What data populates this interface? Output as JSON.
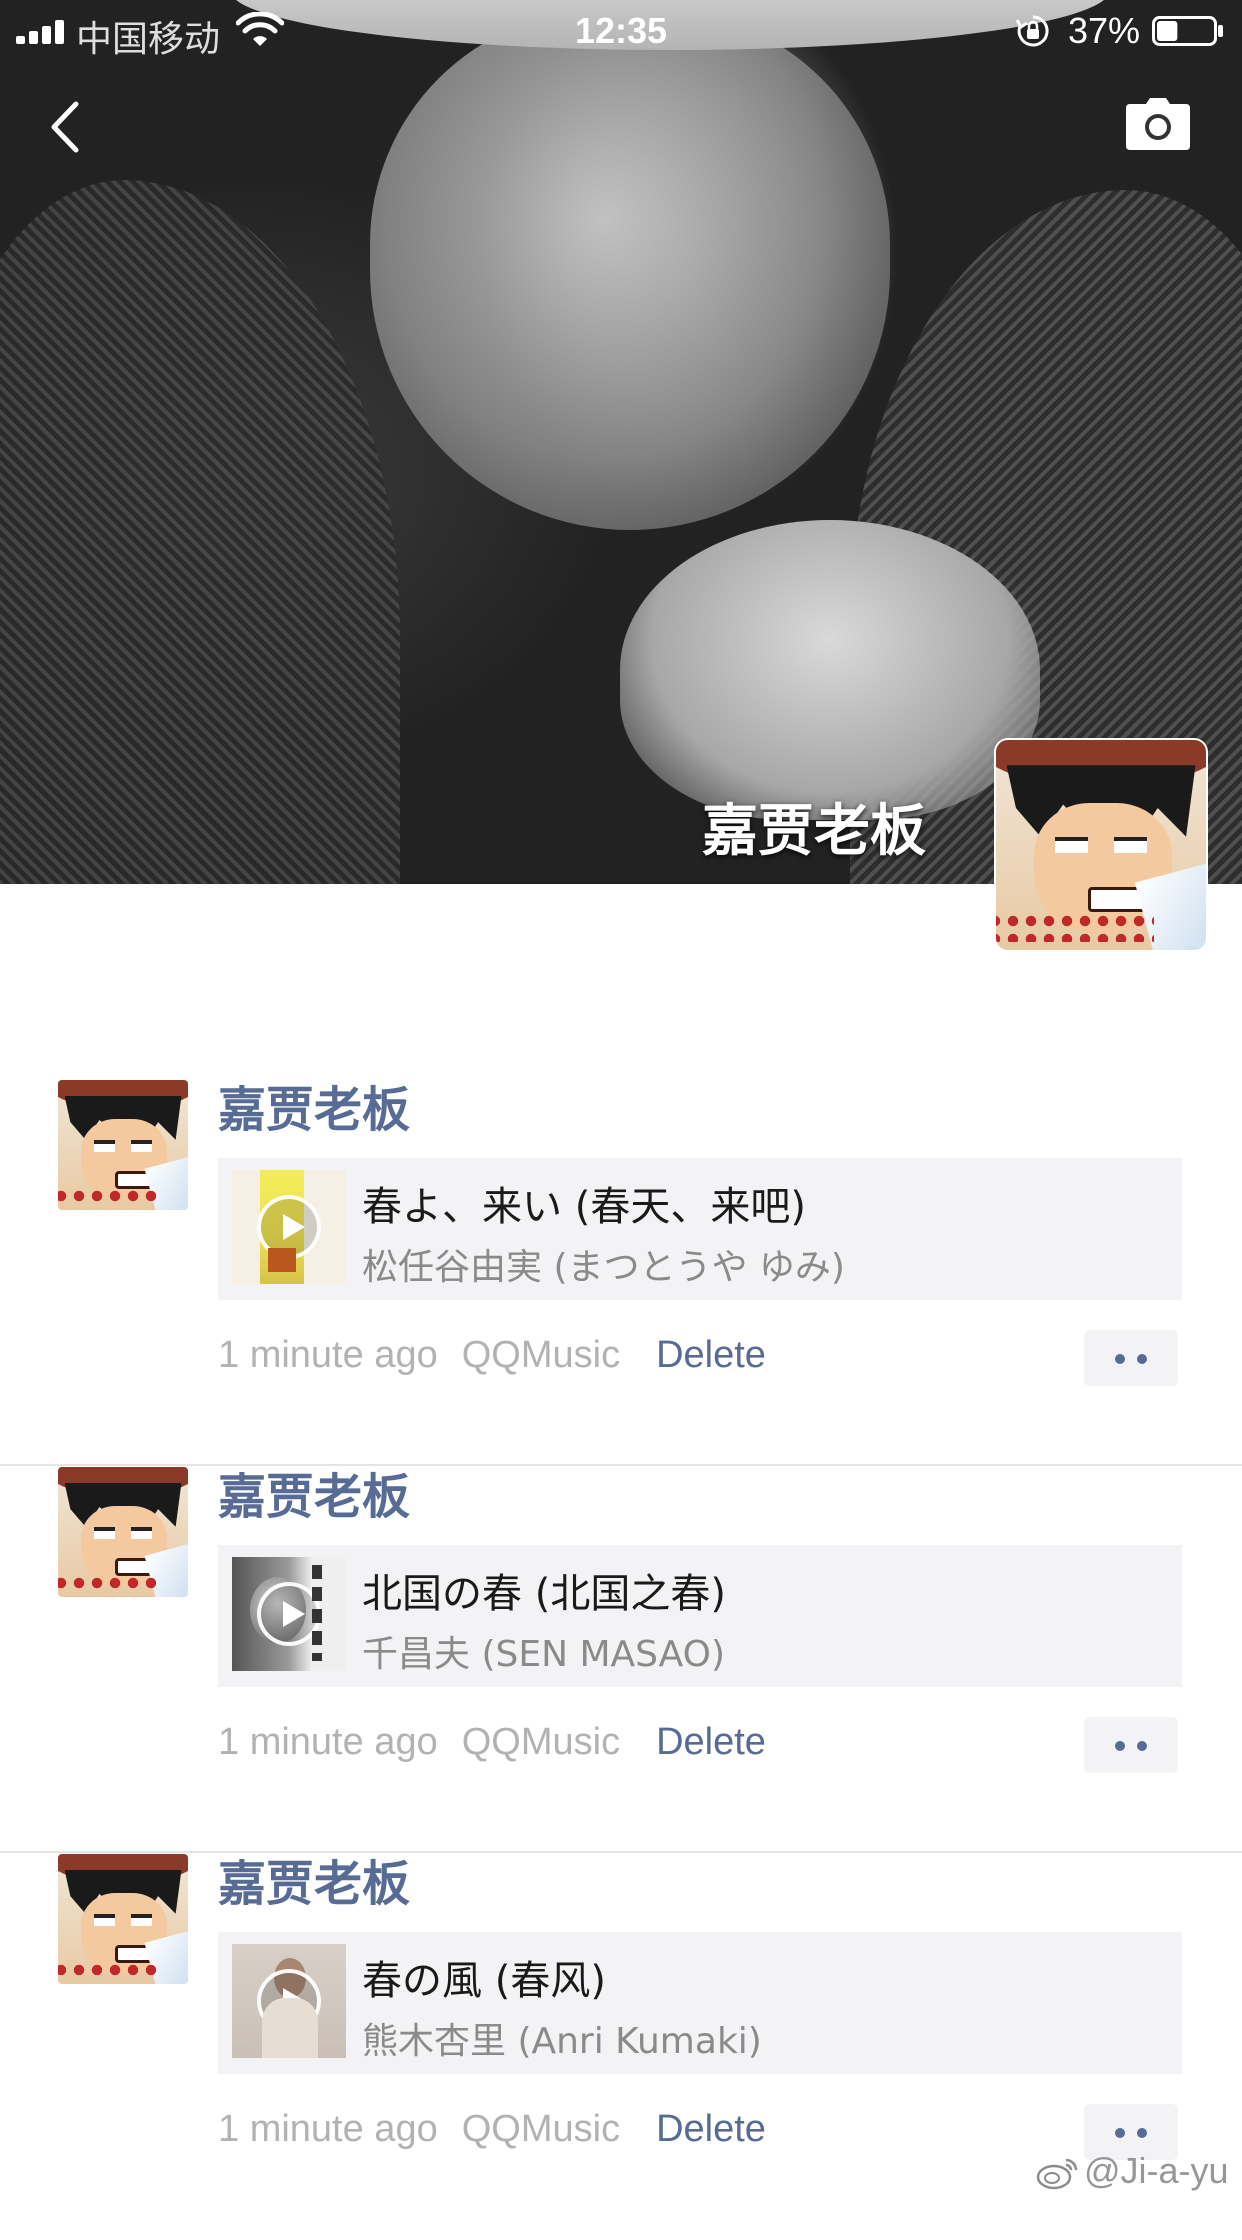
{
  "status_bar": {
    "carrier": "中国移动",
    "time": "12:35",
    "battery_percent": "37%",
    "battery_level": 0.37,
    "signal_bars": 4
  },
  "profile": {
    "name": "嘉贾老板"
  },
  "posts": [
    {
      "author": "嘉贾老板",
      "song_title": "春よ、来い (春天、来吧)",
      "song_artist": "松任谷由実 (まつとうや ゆみ)",
      "time_ago": "1 minute ago",
      "source": "QQMusic",
      "delete_label": "Delete"
    },
    {
      "author": "嘉贾老板",
      "song_title": "北国の春 (北国之春)",
      "song_artist": "千昌夫 (SEN MASAO)",
      "time_ago": "1 minute ago",
      "source": "QQMusic",
      "delete_label": "Delete"
    },
    {
      "author": "嘉贾老板",
      "song_title": "春の風 (春风)",
      "song_artist": "熊木杏里 (Anri Kumaki)",
      "time_ago": "1 minute ago",
      "source": "QQMusic",
      "delete_label": "Delete"
    }
  ],
  "watermark": {
    "text": "@Ji-a-yu"
  },
  "colors": {
    "link_blue": "#576b95",
    "meta_gray": "#b2b2b2",
    "card_bg": "#f3f3f5"
  },
  "icons": {
    "back": "chevron-left-icon",
    "camera": "camera-icon",
    "play": "play-icon",
    "more": "more-dots-icon",
    "wifi": "wifi-icon",
    "battery": "battery-icon",
    "rotation_lock": "rotation-lock-icon",
    "weibo": "weibo-icon"
  }
}
